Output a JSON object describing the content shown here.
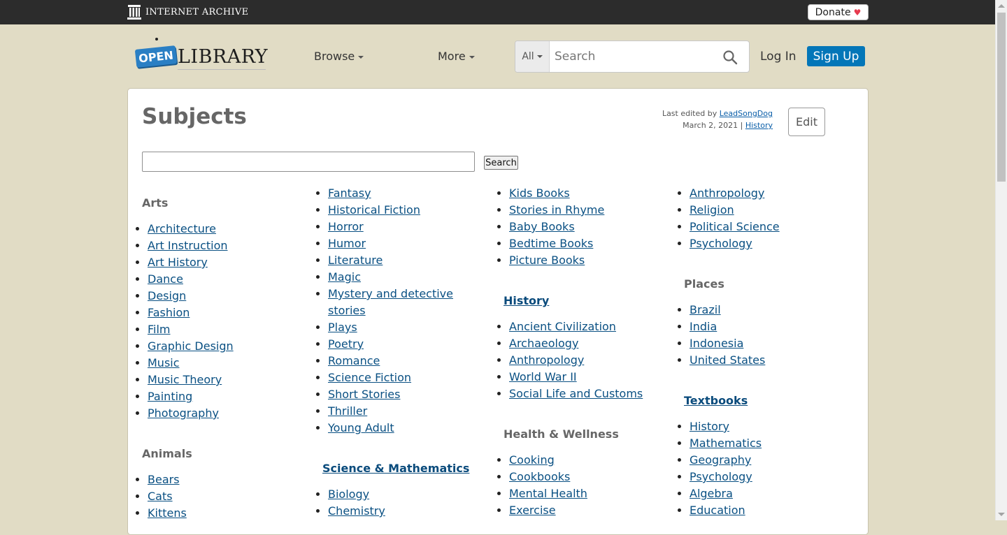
{
  "topbar": {
    "brand": "INTERNET ARCHIVE",
    "donate_label": "Donate",
    "donate_icon": "heart-icon"
  },
  "header": {
    "logo_open": "OPEN",
    "logo_library": "LIBRARY",
    "browse_label": "Browse",
    "more_label": "More",
    "search_scope": "All",
    "search_placeholder": "Search",
    "login_label": "Log In",
    "signup_label": "Sign Up"
  },
  "page": {
    "title": "Subjects",
    "last_edited_prefix": "Last edited by",
    "last_edited_user": "LeadSongDog",
    "last_edited_date": "March 2, 2021 |",
    "history_link": "History",
    "edit_label": "Edit",
    "search_button": "Search"
  },
  "col1": {
    "arts": {
      "title": "Arts",
      "items": [
        "Architecture",
        "Art Instruction",
        "Art History",
        "Dance",
        "Design",
        "Fashion",
        "Film",
        "Graphic Design",
        "Music",
        "Music Theory",
        "Painting",
        "Photography"
      ]
    },
    "animals": {
      "title": "Animals",
      "items": [
        "Bears",
        "Cats",
        "Kittens"
      ]
    }
  },
  "col2": {
    "fiction": {
      "items": [
        "Fantasy",
        "Historical Fiction",
        "Horror",
        "Humor",
        "Literature",
        "Magic",
        "Mystery and detective stories",
        "Plays",
        "Poetry",
        "Romance",
        "Science Fiction",
        "Short Stories",
        "Thriller",
        "Young Adult"
      ]
    },
    "science": {
      "title": "Science & Mathematics",
      "items": [
        "Biology",
        "Chemistry"
      ]
    }
  },
  "col3": {
    "children": {
      "items": [
        "Kids Books",
        "Stories in Rhyme",
        "Baby Books",
        "Bedtime Books",
        "Picture Books"
      ]
    },
    "history": {
      "title": "History",
      "items": [
        "Ancient Civilization",
        "Archaeology",
        "Anthropology",
        "World War II",
        "Social Life and Customs"
      ]
    },
    "health": {
      "title": "Health & Wellness",
      "items": [
        "Cooking",
        "Cookbooks",
        "Mental Health",
        "Exercise"
      ]
    }
  },
  "col4": {
    "social": {
      "items": [
        "Anthropology",
        "Religion",
        "Political Science",
        "Psychology"
      ]
    },
    "places": {
      "title": "Places",
      "items": [
        "Brazil",
        "India",
        "Indonesia",
        "United States"
      ]
    },
    "textbooks": {
      "title": "Textbooks",
      "items": [
        "History",
        "Mathematics",
        "Geography",
        "Psychology",
        "Algebra",
        "Education"
      ]
    }
  }
}
